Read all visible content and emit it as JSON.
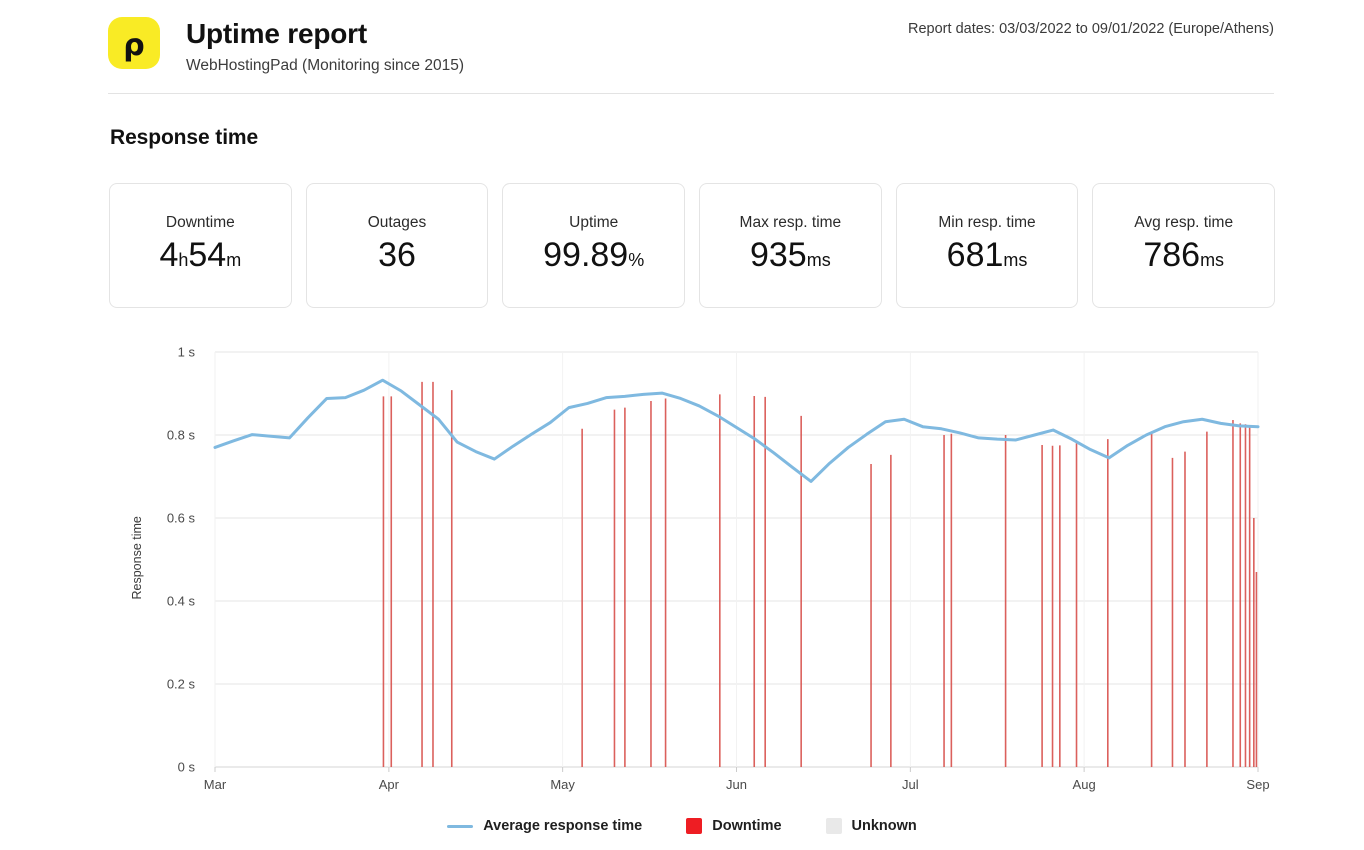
{
  "header": {
    "logo_glyph": "ρ",
    "logo_bg": "#f9eb25",
    "title": "Uptime report",
    "subtitle": "WebHostingPad (Monitoring since 2015)",
    "dates": "Report dates: 03/03/2022 to 09/01/2022 (Europe/Athens)"
  },
  "section": {
    "title": "Response time"
  },
  "cards": [
    {
      "label": "Downtime",
      "value": "4",
      "unit": "h",
      "value2": "54",
      "unit2": "m"
    },
    {
      "label": "Outages",
      "value": "36",
      "unit": "",
      "value2": "",
      "unit2": ""
    },
    {
      "label": "Uptime",
      "value": "99.89",
      "unit": "%",
      "value2": "",
      "unit2": ""
    },
    {
      "label": "Max resp. time",
      "value": "935",
      "unit": "ms",
      "value2": "",
      "unit2": ""
    },
    {
      "label": "Min resp. time",
      "value": "681",
      "unit": "ms",
      "value2": "",
      "unit2": ""
    },
    {
      "label": "Avg resp. time",
      "value": "786",
      "unit": "ms",
      "value2": "",
      "unit2": ""
    }
  ],
  "legend": [
    {
      "name": "average-response-time",
      "label": "Average response time",
      "marker": "line",
      "color": "#7fb9e0"
    },
    {
      "name": "downtime",
      "label": "Downtime",
      "marker": "swatch",
      "color": "#ee1d23"
    },
    {
      "name": "unknown",
      "label": "Unknown",
      "marker": "swatch",
      "color": "#e9e9e9"
    }
  ],
  "chart_data": {
    "type": "line",
    "title": "Response time",
    "xlabel": "",
    "ylabel": "Response time",
    "ylim": [
      0,
      1
    ],
    "yticks": [
      0,
      0.2,
      0.4,
      0.6,
      0.8,
      1
    ],
    "ytick_labels": [
      "0 s",
      "0.2 s",
      "0.4 s",
      "0.6 s",
      "0.8 s",
      "1 s"
    ],
    "xtick_labels": [
      "Mar",
      "Apr",
      "May",
      "Jun",
      "Jul",
      "Aug",
      "Sep"
    ],
    "xtick_positions": [
      0.0,
      0.1667,
      0.3333,
      0.5,
      0.6667,
      0.8333,
      1.0
    ],
    "grid": true,
    "legend_position": "bottom",
    "line_color": "#7fb9e0",
    "downtime_color": "#d9534f",
    "series": [
      {
        "name": "Average response time",
        "units": "s",
        "x": [
          0.004,
          0.03,
          0.058,
          0.086,
          0.112,
          0.139,
          0.166,
          0.193,
          0.22,
          0.247,
          0.274,
          0.301,
          0.328,
          0.355,
          0.382,
          0.409,
          0.436,
          0.463,
          0.49,
          0.517,
          0.544,
          0.571,
          0.598,
          0.625,
          0.652,
          0.679,
          0.706,
          0.733,
          0.76,
          0.787,
          0.814,
          0.841,
          0.868,
          0.895,
          0.922,
          0.949,
          0.976,
          0.996
        ],
        "values": [
          0.77,
          0.785,
          0.8,
          0.797,
          0.793,
          0.845,
          0.888,
          0.89,
          0.905,
          0.93,
          0.905,
          0.872,
          0.838,
          0.782,
          0.76,
          0.742,
          0.772,
          0.8,
          0.828,
          0.866,
          0.875,
          0.89,
          0.893,
          0.898,
          0.9,
          0.888,
          0.87,
          0.845,
          0.818,
          0.79,
          0.758,
          0.722,
          0.688,
          0.73,
          0.768,
          0.8,
          0.83,
          0.836
        ]
      },
      {
        "name": "Average response time (cont.)",
        "units": "s",
        "x": [
          0.996
        ],
        "values": [
          0.836
        ]
      }
    ],
    "line_points_s": [
      0.77,
      0.786,
      0.801,
      0.797,
      0.793,
      0.842,
      0.888,
      0.89,
      0.908,
      0.932,
      0.906,
      0.872,
      0.838,
      0.783,
      0.76,
      0.742,
      0.773,
      0.802,
      0.83,
      0.866,
      0.876,
      0.89,
      0.893,
      0.898,
      0.901,
      0.888,
      0.87,
      0.846,
      0.818,
      0.79,
      0.757,
      0.722,
      0.688,
      0.732,
      0.77,
      0.802,
      0.832,
      0.838,
      0.82,
      0.815,
      0.805,
      0.793,
      0.79,
      0.788,
      0.8,
      0.812,
      0.79,
      0.765,
      0.745,
      0.775,
      0.8,
      0.82,
      0.832,
      0.838,
      0.828,
      0.822,
      0.82
    ],
    "downtime_events": 36,
    "downtime_bars": [
      {
        "x": 0.1615,
        "top_s": 0.893
      },
      {
        "x": 0.169,
        "top_s": 0.893
      },
      {
        "x": 0.1985,
        "top_s": 0.928
      },
      {
        "x": 0.209,
        "top_s": 0.928
      },
      {
        "x": 0.227,
        "top_s": 0.908
      },
      {
        "x": 0.352,
        "top_s": 0.815
      },
      {
        "x": 0.383,
        "top_s": 0.861
      },
      {
        "x": 0.393,
        "top_s": 0.866
      },
      {
        "x": 0.418,
        "top_s": 0.882
      },
      {
        "x": 0.432,
        "top_s": 0.888
      },
      {
        "x": 0.484,
        "top_s": 0.898
      },
      {
        "x": 0.517,
        "top_s": 0.894
      },
      {
        "x": 0.5275,
        "top_s": 0.892
      },
      {
        "x": 0.562,
        "top_s": 0.846
      },
      {
        "x": 0.629,
        "top_s": 0.73
      },
      {
        "x": 0.648,
        "top_s": 0.752
      },
      {
        "x": 0.699,
        "top_s": 0.8
      },
      {
        "x": 0.706,
        "top_s": 0.803
      },
      {
        "x": 0.758,
        "top_s": 0.8
      },
      {
        "x": 0.793,
        "top_s": 0.776
      },
      {
        "x": 0.803,
        "top_s": 0.774
      },
      {
        "x": 0.81,
        "top_s": 0.775
      },
      {
        "x": 0.826,
        "top_s": 0.78
      },
      {
        "x": 0.856,
        "top_s": 0.79
      },
      {
        "x": 0.898,
        "top_s": 0.808
      },
      {
        "x": 0.918,
        "top_s": 0.745
      },
      {
        "x": 0.93,
        "top_s": 0.76
      },
      {
        "x": 0.951,
        "top_s": 0.808
      },
      {
        "x": 0.976,
        "top_s": 0.836
      },
      {
        "x": 0.983,
        "top_s": 0.828
      },
      {
        "x": 0.988,
        "top_s": 0.826
      },
      {
        "x": 0.992,
        "top_s": 0.82
      },
      {
        "x": 0.996,
        "top_s": 0.6
      },
      {
        "x": 0.9985,
        "top_s": 0.47
      }
    ]
  }
}
